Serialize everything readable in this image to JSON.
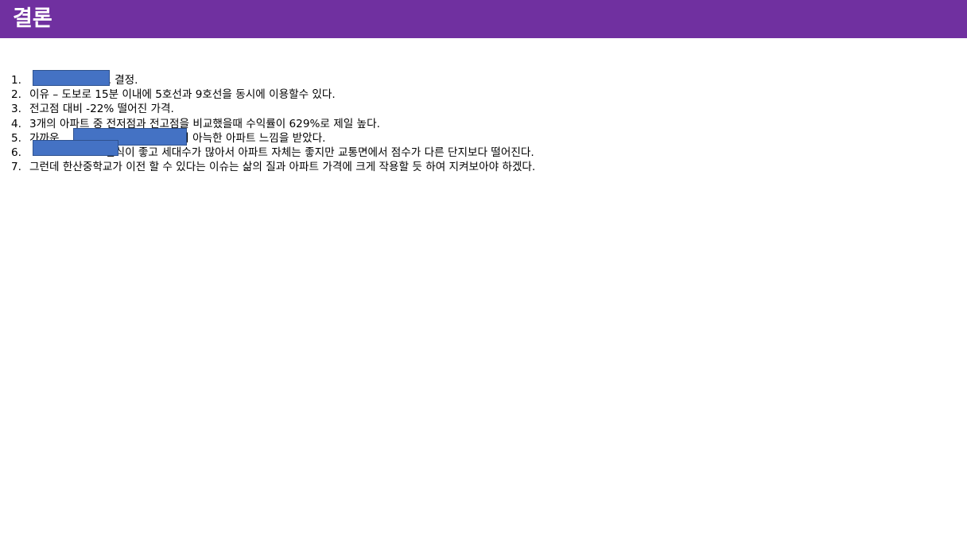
{
  "header": {
    "title": "결론",
    "bar_color": "#7030a0"
  },
  "conclusions": {
    "items": [
      {
        "number": "1.",
        "text": "                  으로 결정."
      },
      {
        "number": "2.",
        "text": "이유 – 도보로 15분 이내에 5호선과 9호선을 동시에 이용할수 있다."
      },
      {
        "number": "3.",
        "text": "전고점 대비 -22% 떨어진 가격."
      },
      {
        "number": "4.",
        "text": "3개의 아파트 중 전저점과 전고점을 비교했을때 수익률이 629%로 제일 높다."
      },
      {
        "number": "5.",
        "text": "가까운                                좀더 아늑한 아파트 느낌을 받았다."
      },
      {
        "number": "6.",
        "text": "                      연식이 좋고 세대수가 많아서 아파트 자체는 좋지만 교통면에서 점수가 다른 단지보다 떨어진다."
      },
      {
        "number": "7.",
        "text": "그런데 한산중학교가 이전 할 수 있다는 이슈는 삶의 질과 아파트 가격에 크게 작용할 듯 하여 지켜보아야 하겠다."
      }
    ]
  },
  "redaction_color": "#4472c4"
}
